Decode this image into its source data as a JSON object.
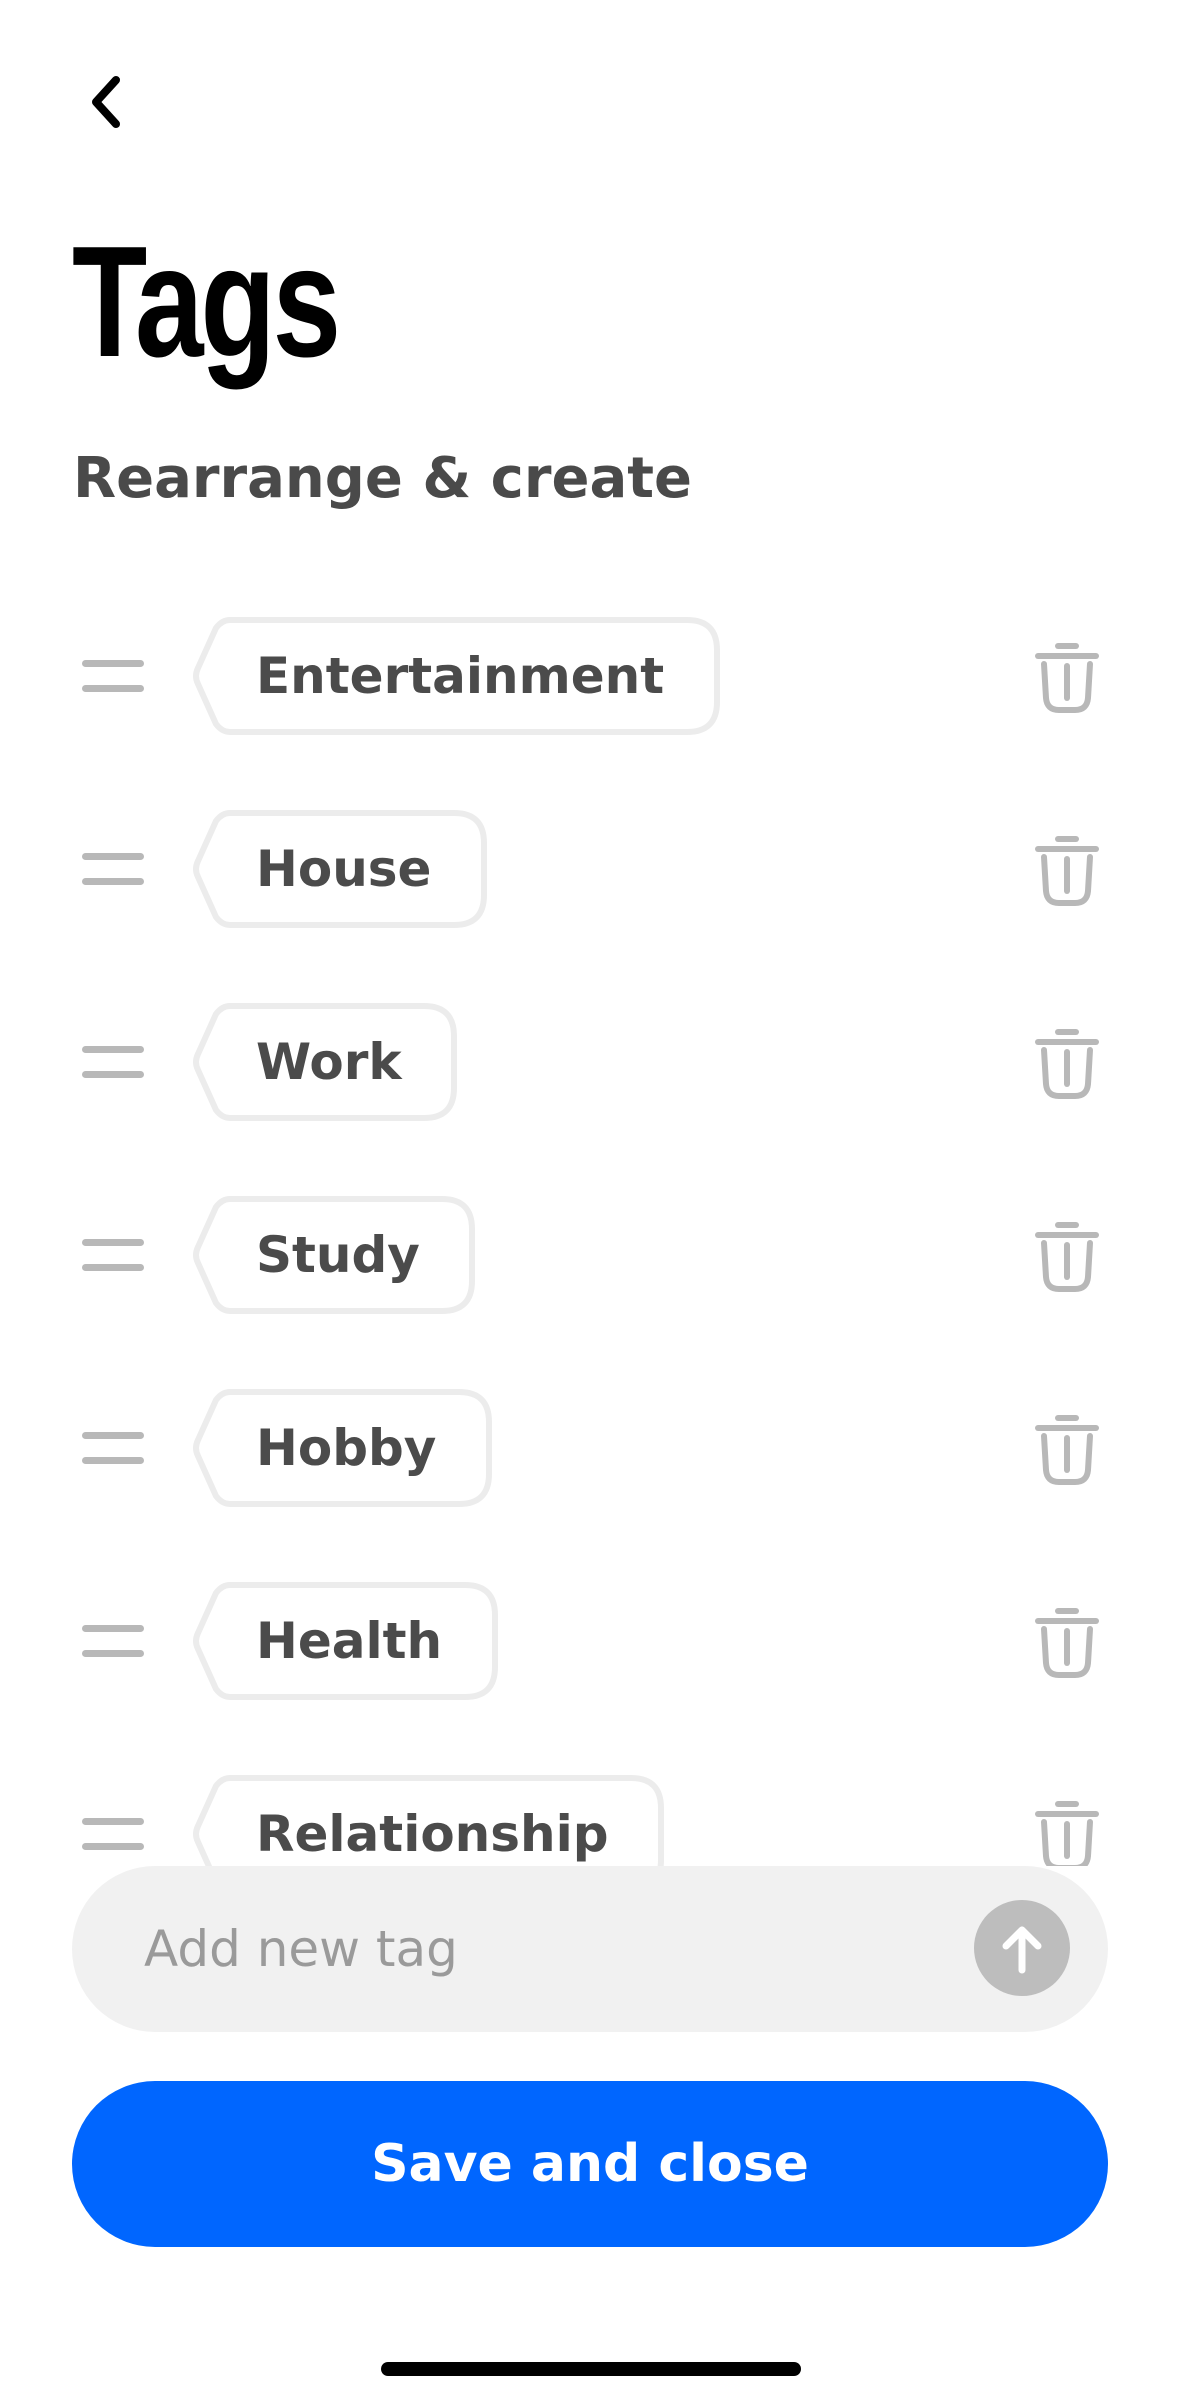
{
  "header": {
    "back_icon": "chevron-left-icon",
    "title": "Tags",
    "subtitle": "Rearrange & create"
  },
  "tags": [
    {
      "label": "Entertainment"
    },
    {
      "label": "House"
    },
    {
      "label": "Work"
    },
    {
      "label": "Study"
    },
    {
      "label": "Hobby"
    },
    {
      "label": "Health"
    },
    {
      "label": "Relationship"
    }
  ],
  "add_tag": {
    "placeholder": "Add new tag",
    "send_icon": "arrow-up-icon"
  },
  "footer": {
    "save_label": "Save and close"
  },
  "colors": {
    "accent": "#0066ff",
    "text_primary": "#000000",
    "text_secondary": "#4b4b4b",
    "icon_muted": "#b8b8b8",
    "chip_border": "#ececec",
    "input_bg": "#f1f1f1",
    "send_bg": "#bdbdbd"
  }
}
